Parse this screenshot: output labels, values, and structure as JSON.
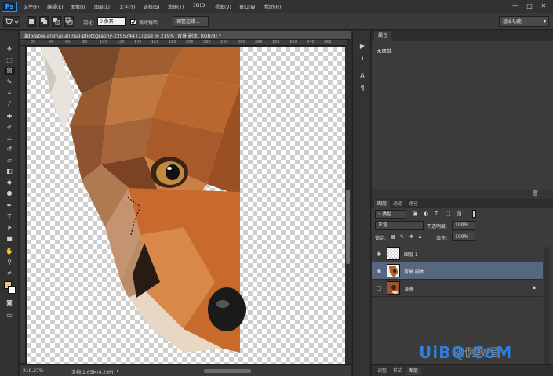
{
  "app": {
    "logo": "Ps"
  },
  "menu": [
    "文件(F)",
    "编辑(E)",
    "图像(I)",
    "图层(L)",
    "文字(Y)",
    "选择(S)",
    "滤镜(T)",
    "3D(D)",
    "视图(V)",
    "窗口(W)",
    "帮助(H)"
  ],
  "window_controls": {
    "minimize": "—",
    "maximize": "□",
    "close": "✕"
  },
  "options": {
    "feather_label": "羽化:",
    "feather_value": "0 像素",
    "antialias_label": "消除锯齿",
    "refine_edge": "调整边缘...",
    "workspace": "基本功能"
  },
  "document": {
    "tab_title": "adorable-animal-animal-photography-2295744 (1).psd @ 219% (背景 副本, RGB/8) *",
    "ruler_marks": [
      "20",
      "40",
      "60",
      "80",
      "100",
      "120",
      "140",
      "160",
      "180",
      "200",
      "220",
      "240",
      "260",
      "280",
      "300",
      "320",
      "340",
      "360"
    ],
    "zoom": "219.27%",
    "doc_size": "文档:1.65M/4.29M"
  },
  "properties": {
    "tab": "属性",
    "content": "无属性"
  },
  "layers": {
    "tabs": [
      "图层",
      "通道",
      "路径"
    ],
    "filter_kind": "类型",
    "blend_mode": "正常",
    "opacity_label": "不透明度:",
    "opacity_value": "100%",
    "lock_label": "锁定:",
    "fill_label": "填充:",
    "fill_value": "100%",
    "items": [
      {
        "name": "图层 1",
        "visible": true,
        "selected": false
      },
      {
        "name": "背景 副本",
        "visible": true,
        "selected": true
      },
      {
        "name": "背景",
        "visible": false,
        "selected": false,
        "locked": true
      }
    ],
    "bottom_tabs": [
      "调整",
      "样式",
      "图层"
    ]
  },
  "watermark": {
    "text": "UiBQ.CoM",
    "cn_text": "实例教程"
  }
}
